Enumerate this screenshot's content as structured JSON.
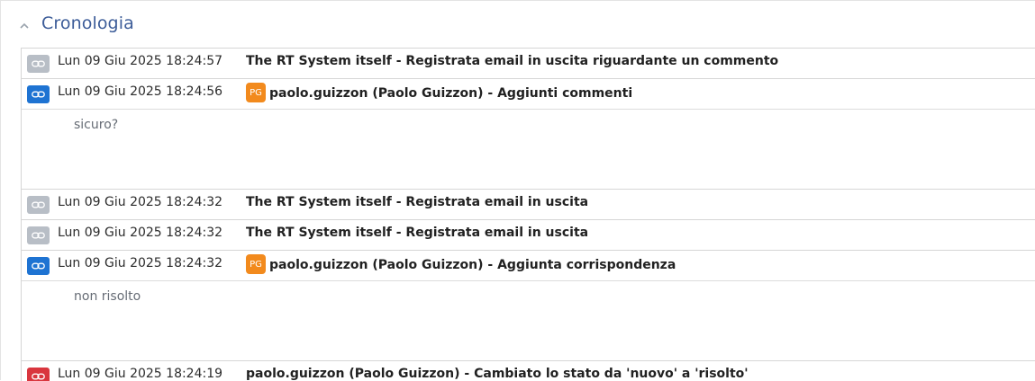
{
  "section": {
    "title": "Cronologia",
    "chevron_icon": "chevron-up-icon"
  },
  "colors": {
    "title": "#3d5d99",
    "icon_system": "#b8bec6",
    "icon_comment": "#1e73d2",
    "icon_status": "#d9363e",
    "avatar": "#f28a1d"
  },
  "entries": [
    {
      "icon": "link-icon",
      "icon_color": "#b8bec6",
      "timestamp": "Lun 09 Giu 2025 18:24:57",
      "description": "The RT System itself - Registrata email in uscita riguardante un commento",
      "avatar": "",
      "content": ""
    },
    {
      "icon": "link-icon",
      "icon_color": "#1e73d2",
      "timestamp": "Lun 09 Giu 2025 18:24:56",
      "description": "paolo.guizzon (Paolo Guizzon) - Aggiunti commenti",
      "avatar": "PG",
      "content": "sicuro?"
    },
    {
      "icon": "link-icon",
      "icon_color": "#b8bec6",
      "timestamp": "Lun 09 Giu 2025 18:24:32",
      "description": "The RT System itself - Registrata email in uscita",
      "avatar": "",
      "content": ""
    },
    {
      "icon": "link-icon",
      "icon_color": "#b8bec6",
      "timestamp": "Lun 09 Giu 2025 18:24:32",
      "description": "The RT System itself - Registrata email in uscita",
      "avatar": "",
      "content": ""
    },
    {
      "icon": "link-icon",
      "icon_color": "#1e73d2",
      "timestamp": "Lun 09 Giu 2025 18:24:32",
      "description": "paolo.guizzon (Paolo Guizzon) - Aggiunta corrispondenza",
      "avatar": "PG",
      "content": "non risolto"
    },
    {
      "icon": "link-icon",
      "icon_color": "#d9363e",
      "timestamp": "Lun 09 Giu 2025 18:24:19",
      "description": "paolo.guizzon (Paolo Guizzon) - Cambiato lo stato da 'nuovo' a 'risolto'",
      "avatar": "",
      "content": ""
    }
  ]
}
